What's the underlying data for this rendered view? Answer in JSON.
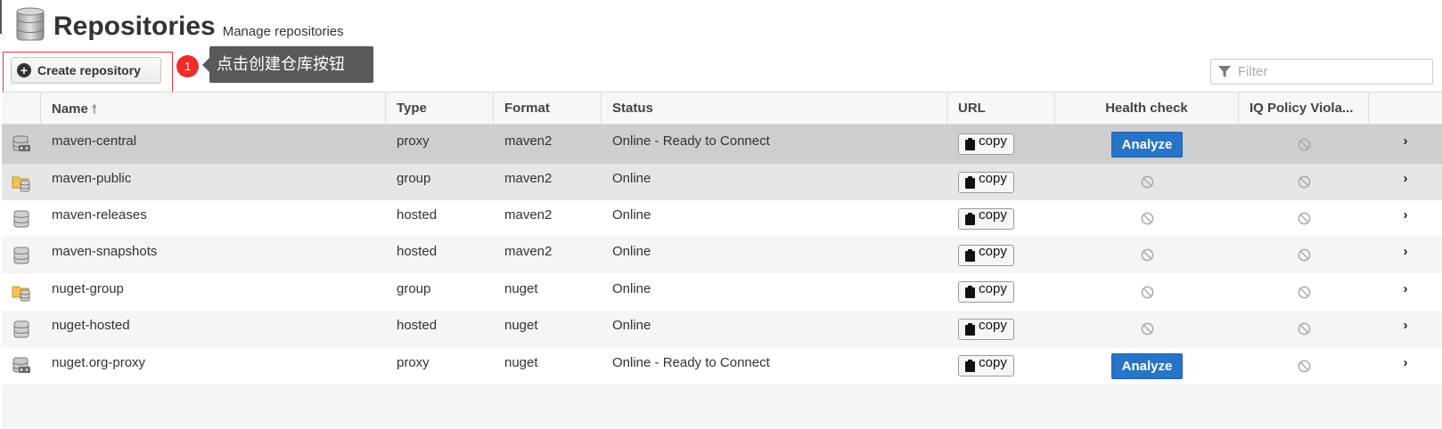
{
  "header": {
    "title": "Repositories",
    "subtitle": "Manage repositories",
    "icon": "database-icon"
  },
  "toolbar": {
    "create_label": "Create repository",
    "annotation_number": "1",
    "annotation_text": "点击创建仓库按钮",
    "filter_placeholder": "Filter"
  },
  "columns": {
    "name": "Name",
    "type": "Type",
    "format": "Format",
    "status": "Status",
    "url": "URL",
    "health": "Health check",
    "iq": "IQ Policy Viola..."
  },
  "copy_label": "copy",
  "analyze_label": "Analyze",
  "rows": [
    {
      "name": "maven-central",
      "type": "proxy",
      "format": "maven2",
      "status": "Online - Ready to Connect",
      "icon": "proxy-repo-icon",
      "health": "analyze",
      "selected": true
    },
    {
      "name": "maven-public",
      "type": "group",
      "format": "maven2",
      "status": "Online",
      "icon": "group-repo-icon",
      "health": "none",
      "hover": true
    },
    {
      "name": "maven-releases",
      "type": "hosted",
      "format": "maven2",
      "status": "Online",
      "icon": "hosted-repo-icon",
      "health": "none"
    },
    {
      "name": "maven-snapshots",
      "type": "hosted",
      "format": "maven2",
      "status": "Online",
      "icon": "hosted-repo-icon",
      "health": "none"
    },
    {
      "name": "nuget-group",
      "type": "group",
      "format": "nuget",
      "status": "Online",
      "icon": "group-repo-icon",
      "health": "none"
    },
    {
      "name": "nuget-hosted",
      "type": "hosted",
      "format": "nuget",
      "status": "Online",
      "icon": "hosted-repo-icon",
      "health": "none"
    },
    {
      "name": "nuget.org-proxy",
      "type": "proxy",
      "format": "nuget",
      "status": "Online - Ready to Connect",
      "icon": "proxy-repo-icon",
      "health": "analyze"
    }
  ]
}
